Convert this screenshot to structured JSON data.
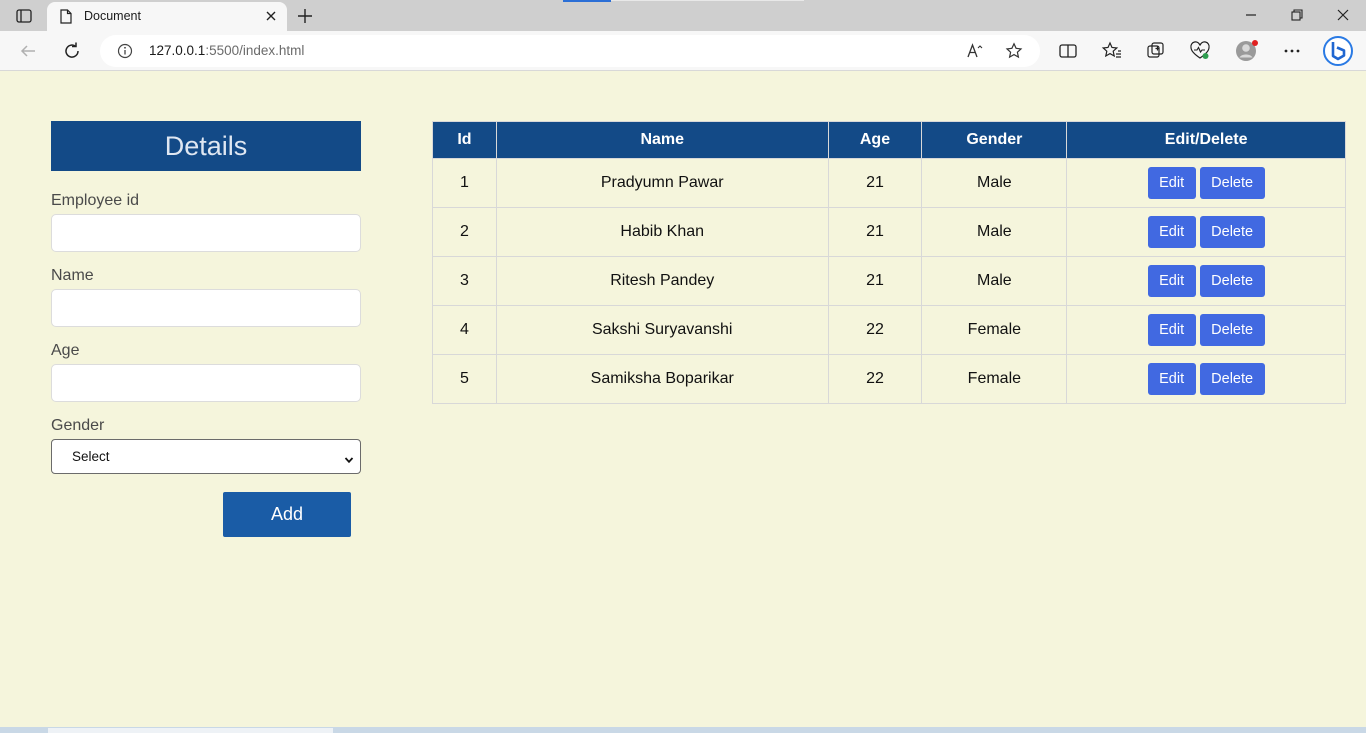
{
  "browser": {
    "tab_title": "Document",
    "url_host": "127.0.0.1",
    "url_rest": ":5500/index.html"
  },
  "form": {
    "title": "Details",
    "employee_id_label": "Employee id",
    "name_label": "Name",
    "age_label": "Age",
    "gender_label": "Gender",
    "gender_selected": "Select",
    "add_label": "Add"
  },
  "table": {
    "headers": [
      "Id",
      "Name",
      "Age",
      "Gender",
      "Edit/Delete"
    ],
    "edit_label": "Edit",
    "delete_label": "Delete",
    "rows": [
      {
        "id": "1",
        "name": "Pradyumn Pawar",
        "age": "21",
        "gender": "Male"
      },
      {
        "id": "2",
        "name": "Habib Khan",
        "age": "21",
        "gender": "Male"
      },
      {
        "id": "3",
        "name": "Ritesh Pandey",
        "age": "21",
        "gender": "Male"
      },
      {
        "id": "4",
        "name": "Sakshi Suryavanshi",
        "age": "22",
        "gender": "Female"
      },
      {
        "id": "5",
        "name": "Samiksha Boparikar",
        "age": "22",
        "gender": "Female"
      }
    ]
  },
  "colors": {
    "page_bg": "#f5f5dc",
    "header_blue": "#134a87",
    "button_blue": "#4169e1",
    "add_blue": "#1a5ca6"
  }
}
